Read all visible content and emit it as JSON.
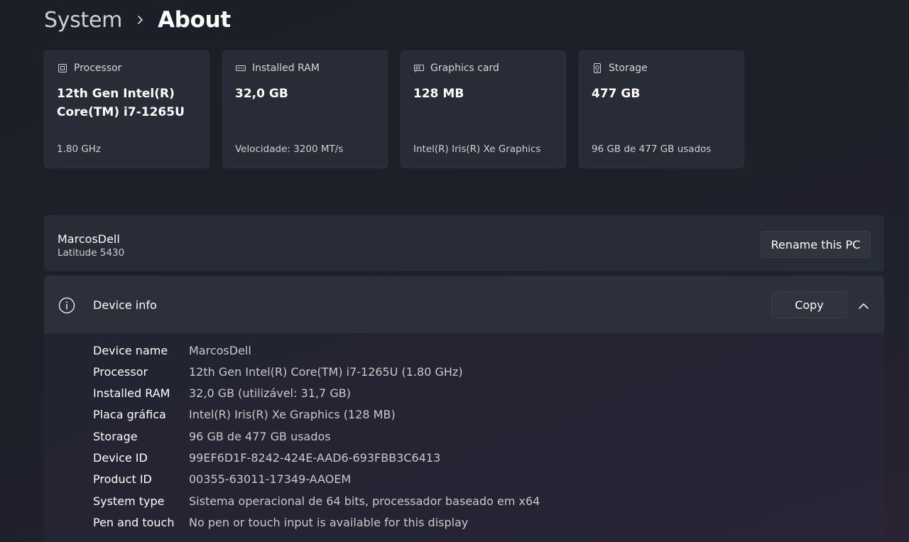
{
  "breadcrumb": {
    "parent": "System",
    "current": "About"
  },
  "cards": [
    {
      "icon": "processor-icon",
      "title": "Processor",
      "value": "12th Gen Intel(R) Core(TM) i7-1265U",
      "sub": "1.80 GHz"
    },
    {
      "icon": "ram-icon",
      "title": "Installed RAM",
      "value": "32,0 GB",
      "sub": "Velocidade: 3200 MT/s"
    },
    {
      "icon": "graphics-card-icon",
      "title": "Graphics card",
      "value": "128 MB",
      "sub": "Intel(R) Iris(R) Xe Graphics"
    },
    {
      "icon": "storage-icon",
      "title": "Storage",
      "value": "477 GB",
      "sub": "96 GB de 477 GB usados"
    }
  ],
  "pc": {
    "name": "MarcosDell",
    "model": "Latitude 5430",
    "rename_label": "Rename this PC"
  },
  "device_info": {
    "title": "Device info",
    "copy_label": "Copy",
    "rows": [
      {
        "label": "Device name",
        "value": "MarcosDell"
      },
      {
        "label": "Processor",
        "value": "12th Gen Intel(R) Core(TM) i7-1265U (1.80 GHz)"
      },
      {
        "label": "Installed RAM",
        "value": "32,0 GB (utilizável: 31,7 GB)"
      },
      {
        "label": "Placa gráfica",
        "value": "Intel(R) Iris(R) Xe Graphics (128 MB)"
      },
      {
        "label": "Storage",
        "value": "96 GB de 477 GB usados"
      },
      {
        "label": "Device ID",
        "value": "99EF6D1F-8242-424E-AAD6-693FBB3C6413"
      },
      {
        "label": "Product ID",
        "value": "00355-63011-17349-AAOEM"
      },
      {
        "label": "System type",
        "value": "Sistema operacional de 64 bits, processador baseado em x64"
      },
      {
        "label": "Pen and touch",
        "value": "No pen or touch input is available for this display"
      }
    ]
  }
}
